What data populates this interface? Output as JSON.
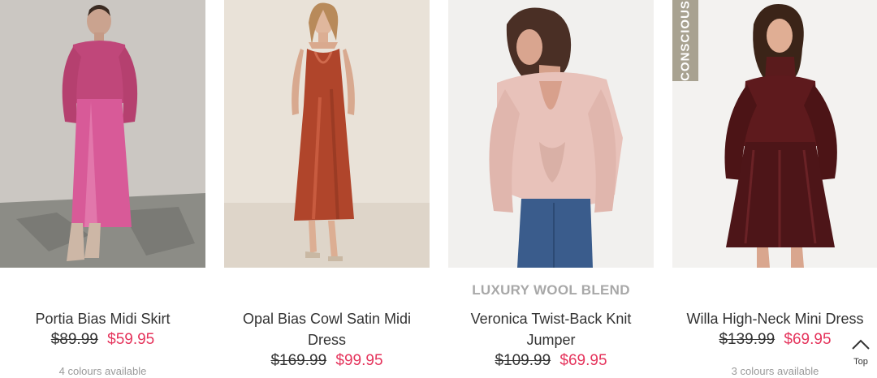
{
  "products": [
    {
      "name": "Portia Bias Midi Skirt",
      "was_price": "$89.99",
      "now_price": "$59.95",
      "colours": "4 colours available"
    },
    {
      "name": "Opal Bias Cowl Satin Midi Dress",
      "was_price": "$169.99",
      "now_price": "$99.95",
      "colours": ""
    },
    {
      "feature": "LUXURY WOOL BLEND",
      "name": "Veronica Twist-Back Knit Jumper",
      "was_price": "$109.99",
      "now_price": "$69.95",
      "colours": ""
    },
    {
      "badge": "CONSCIOUS",
      "name": "Willa High-Neck Mini Dress",
      "was_price": "$139.99",
      "now_price": "$69.95",
      "colours": "3 colours available"
    }
  ],
  "top_button": {
    "label": "Top",
    "icon": "chevron-up-icon"
  },
  "colors": {
    "sale_price": "#e5345c",
    "badge_bg": "#a8a291",
    "feature_text": "#a8a8a8"
  }
}
